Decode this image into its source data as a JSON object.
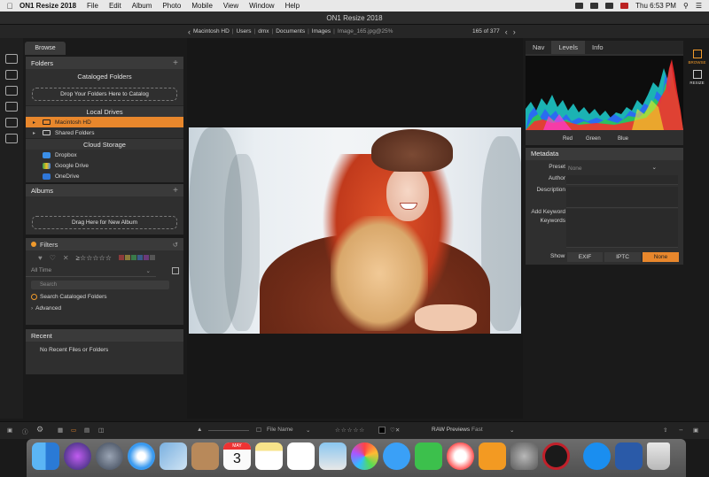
{
  "menubar": {
    "app_name": "ON1 Resize 2018",
    "items": [
      "File",
      "Edit",
      "Album",
      "Photo",
      "Mobile",
      "View",
      "Window",
      "Help"
    ],
    "clock": "Thu 6:53 PM"
  },
  "window": {
    "title": "ON1 Resize 2018"
  },
  "pathbar": {
    "crumbs": [
      "Macintosh HD",
      "Users",
      "dmx",
      "Documents",
      "Images",
      "Image_165.jpg@25%"
    ],
    "counter": "165 of 377"
  },
  "left": {
    "tab_label": "Browse",
    "folders": {
      "title": "Folders",
      "cataloged_title": "Cataloged Folders",
      "drop_hint": "Drop Your Folders Here to Catalog",
      "local_title": "Local Drives",
      "local_items": [
        "Macintosh HD",
        "Shared Folders"
      ],
      "cloud_title": "Cloud Storage",
      "cloud_items": [
        "Dropbox",
        "Google Drive",
        "OneDrive"
      ]
    },
    "albums": {
      "title": "Albums",
      "drop_hint": "Drag Here for New Album"
    },
    "filters": {
      "title": "Filters",
      "rating_prefix": "≥☆☆☆☆☆",
      "time_value": "All Time",
      "search_placeholder": "Search",
      "search_cataloged": "Search Cataloged Folders",
      "advanced": "Advanced"
    },
    "recent": {
      "title": "Recent",
      "empty": "No Recent Files or Folders"
    }
  },
  "right": {
    "tabs": [
      "Nav",
      "Levels",
      "Info"
    ],
    "channels": [
      "Red",
      "Green",
      "Blue"
    ],
    "metadata": {
      "title": "Metadata",
      "preset_label": "Preset",
      "preset_value": "None",
      "author_label": "Author",
      "description_label": "Description",
      "add_keyword_label": "Add Keyword",
      "keywords_label": "Keywords",
      "show_label": "Show",
      "show_options": [
        "EXIF",
        "IPTC",
        "None"
      ]
    },
    "modules": [
      "BROWSE",
      "RESIZE"
    ]
  },
  "bottombar": {
    "sort_label": "File Name",
    "raw_label": "RAW Previews",
    "raw_value": "Fast"
  },
  "dock": {
    "calendar_month": "MAY",
    "calendar_day": "3"
  },
  "colors": {
    "accent": "#e8872c",
    "panel": "#2f2f2f",
    "background": "#171717"
  }
}
